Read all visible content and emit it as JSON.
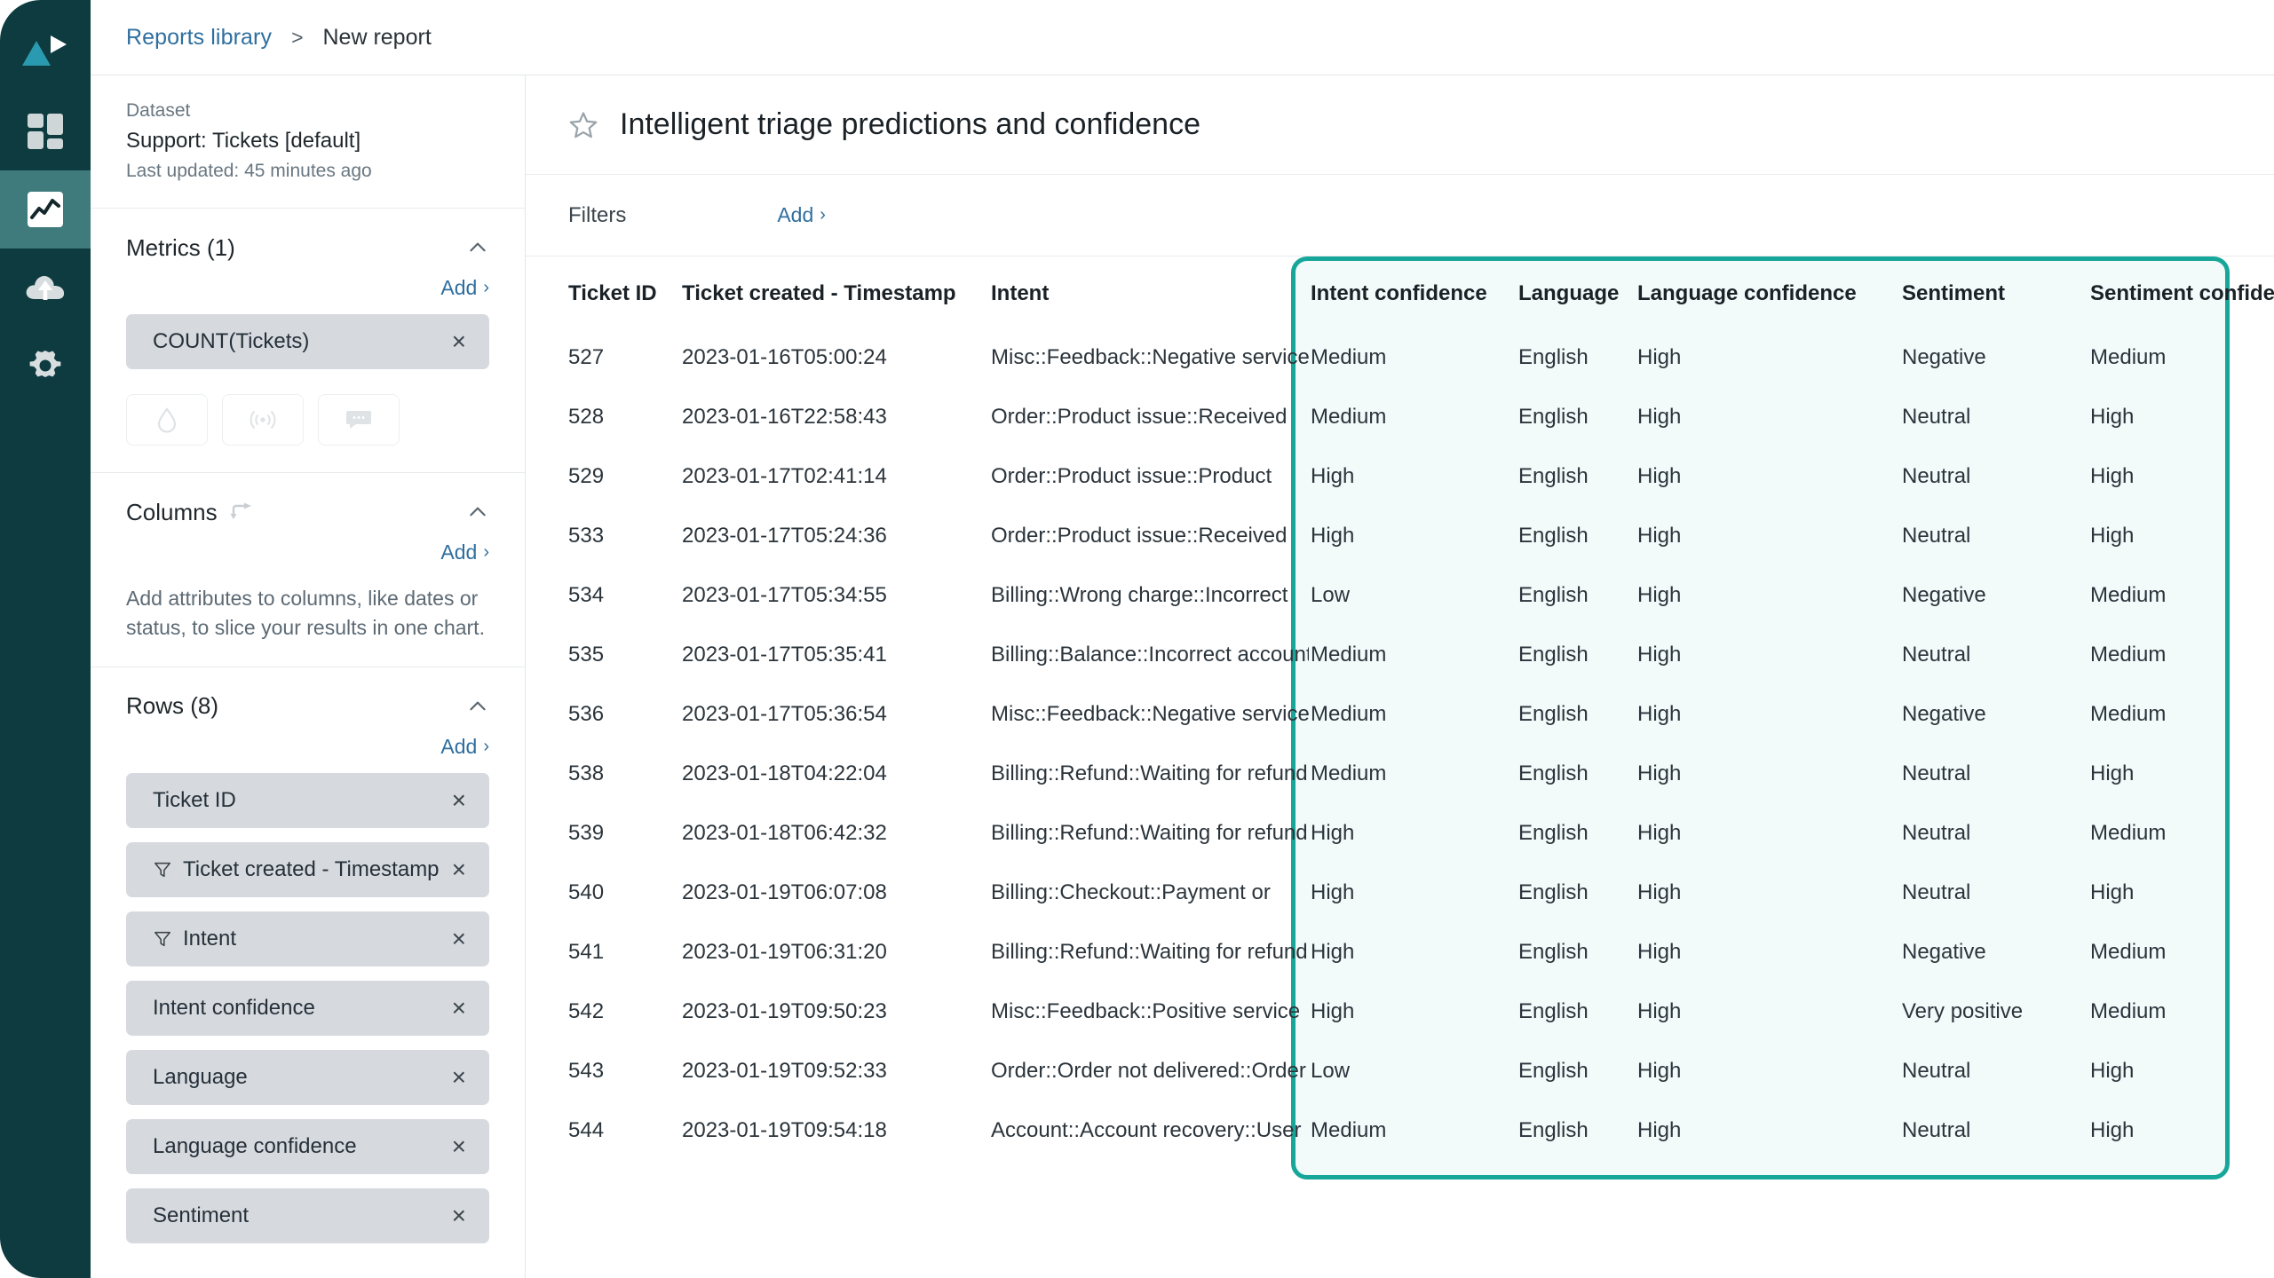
{
  "rail": {
    "items": [
      {
        "name": "logo",
        "icon": "play-triangle-logo"
      },
      {
        "name": "dashboard",
        "icon": "grid-icon",
        "active": false
      },
      {
        "name": "reports",
        "icon": "line-chart-icon",
        "active": true
      },
      {
        "name": "upload",
        "icon": "cloud-upload-icon",
        "active": false
      },
      {
        "name": "settings",
        "icon": "gear-icon",
        "active": false
      }
    ]
  },
  "breadcrumb": {
    "root": "Reports library",
    "separator": ">",
    "current": "New report"
  },
  "sidebar": {
    "dataset": {
      "label": "Dataset",
      "name": "Support: Tickets [default]",
      "updated": "Last updated: 45 minutes ago"
    },
    "metrics": {
      "title": "Metrics (1)",
      "add_label": "Add",
      "add_caret": "›",
      "chips": [
        {
          "label": "COUNT(Tickets)",
          "remove": "×"
        }
      ],
      "viz_buttons": [
        {
          "name": "drop-icon"
        },
        {
          "name": "signal-icon"
        },
        {
          "name": "chat-bubble-icon"
        }
      ]
    },
    "columns": {
      "title": "Columns",
      "add_label": "Add",
      "add_caret": "›",
      "hint": "Add attributes to columns, like dates or status, to slice your results in one chart."
    },
    "rows": {
      "title": "Rows (8)",
      "add_label": "Add",
      "add_caret": "›",
      "chips": [
        {
          "label": "Ticket ID",
          "filtered": false,
          "remove": "×"
        },
        {
          "label": "Ticket created - Timestamp",
          "filtered": true,
          "remove": "×"
        },
        {
          "label": "Intent",
          "filtered": true,
          "remove": "×"
        },
        {
          "label": "Intent confidence",
          "filtered": false,
          "remove": "×"
        },
        {
          "label": "Language",
          "filtered": false,
          "remove": "×"
        },
        {
          "label": "Language confidence",
          "filtered": false,
          "remove": "×"
        },
        {
          "label": "Sentiment",
          "filtered": false,
          "remove": "×"
        }
      ]
    }
  },
  "report": {
    "title": "Intelligent triage predictions and confidence",
    "star": "star-outline-icon",
    "filters_label": "Filters",
    "filters_add_label": "Add",
    "filters_add_caret": "›"
  },
  "table": {
    "headers": [
      "Ticket ID",
      "Ticket created - Timestamp",
      "Intent",
      "Intent confidence",
      "Language",
      "Language confidence",
      "Sentiment",
      "Sentiment confidence"
    ],
    "rows": [
      [
        "527",
        "2023-01-16T05:00:24",
        "Misc::Feedback::Negative service",
        "Medium",
        "English",
        "High",
        "Negative",
        "Medium"
      ],
      [
        "528",
        "2023-01-16T22:58:43",
        "Order::Product issue::Received",
        "Medium",
        "English",
        "High",
        "Neutral",
        "High"
      ],
      [
        "529",
        "2023-01-17T02:41:14",
        "Order::Product issue::Product",
        "High",
        "English",
        "High",
        "Neutral",
        "High"
      ],
      [
        "533",
        "2023-01-17T05:24:36",
        "Order::Product issue::Received",
        "High",
        "English",
        "High",
        "Neutral",
        "High"
      ],
      [
        "534",
        "2023-01-17T05:34:55",
        "Billing::Wrong charge::Incorrect",
        "Low",
        "English",
        "High",
        "Negative",
        "Medium"
      ],
      [
        "535",
        "2023-01-17T05:35:41",
        "Billing::Balance::Incorrect account",
        "Medium",
        "English",
        "High",
        "Neutral",
        "Medium"
      ],
      [
        "536",
        "2023-01-17T05:36:54",
        "Misc::Feedback::Negative service",
        "Medium",
        "English",
        "High",
        "Negative",
        "Medium"
      ],
      [
        "538",
        "2023-01-18T04:22:04",
        "Billing::Refund::Waiting for refund",
        "Medium",
        "English",
        "High",
        "Neutral",
        "High"
      ],
      [
        "539",
        "2023-01-18T06:42:32",
        "Billing::Refund::Waiting for refund",
        "High",
        "English",
        "High",
        "Neutral",
        "Medium"
      ],
      [
        "540",
        "2023-01-19T06:07:08",
        "Billing::Checkout::Payment or",
        "High",
        "English",
        "High",
        "Neutral",
        "High"
      ],
      [
        "541",
        "2023-01-19T06:31:20",
        "Billing::Refund::Waiting for refund",
        "High",
        "English",
        "High",
        "Negative",
        "Medium"
      ],
      [
        "542",
        "2023-01-19T09:50:23",
        "Misc::Feedback::Positive service",
        "High",
        "English",
        "High",
        "Very positive",
        "Medium"
      ],
      [
        "543",
        "2023-01-19T09:52:33",
        "Order::Order not delivered::Order",
        "Low",
        "English",
        "High",
        "Neutral",
        "High"
      ],
      [
        "544",
        "2023-01-19T09:54:18",
        "Account::Account recovery::User",
        "Medium",
        "English",
        "High",
        "Neutral",
        "High"
      ]
    ],
    "highlight": {
      "from_column_index": 3,
      "border_color": "#17a79a",
      "fill_color": "#f2fbfa"
    }
  },
  "colors": {
    "rail_bg": "#0d3b40",
    "rail_active": "#3f7a7c",
    "logo_accent": "#2a9ab0",
    "link": "#2f6f9f",
    "chip_bg": "#d6dade",
    "highlight_border": "#17a79a",
    "highlight_fill": "#f2fbfa"
  }
}
